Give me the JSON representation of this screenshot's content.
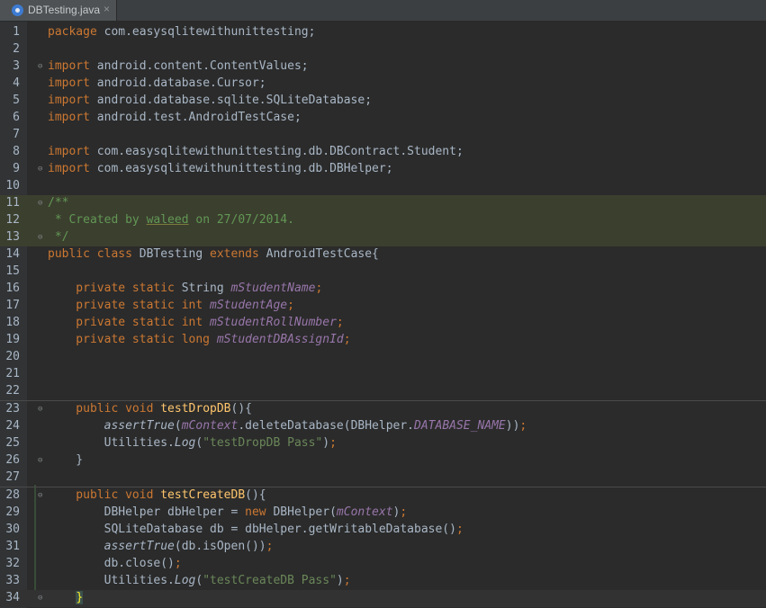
{
  "tab": {
    "title": "DBTesting.java",
    "close": "×"
  },
  "lines": [
    {
      "n": "1",
      "segs": [
        [
          "kw",
          "package"
        ],
        [
          "",
          "com.easysqlitewithunittesting;"
        ]
      ]
    },
    {
      "n": "2",
      "segs": []
    },
    {
      "n": "3",
      "fold": true,
      "segs": [
        [
          "kw",
          "import"
        ],
        [
          "",
          "android.content.ContentValues;"
        ]
      ]
    },
    {
      "n": "4",
      "segs": [
        [
          "kw",
          "import"
        ],
        [
          "",
          "android.database.Cursor;"
        ]
      ]
    },
    {
      "n": "5",
      "segs": [
        [
          "kw",
          "import"
        ],
        [
          "",
          "android.database.sqlite.SQLiteDatabase;"
        ]
      ]
    },
    {
      "n": "6",
      "segs": [
        [
          "kw",
          "import"
        ],
        [
          "",
          "android.test.AndroidTestCase;"
        ]
      ]
    },
    {
      "n": "7",
      "segs": []
    },
    {
      "n": "8",
      "segs": [
        [
          "kw",
          "import"
        ],
        [
          "",
          "com.easysqlitewithunittesting.db.DBContract.Student;"
        ]
      ]
    },
    {
      "n": "9",
      "fold": true,
      "segs": [
        [
          "kw",
          "import"
        ],
        [
          "",
          "com.easysqlitewithunittesting.db.DBHelper;"
        ]
      ]
    },
    {
      "n": "10",
      "segs": []
    },
    {
      "n": "11",
      "fold": true,
      "hl": true,
      "segs": [
        [
          "dc",
          "/**"
        ]
      ]
    },
    {
      "n": "12",
      "hl": true,
      "segs": [
        [
          "dc",
          " * Created by "
        ],
        [
          "dc u",
          "waleed"
        ],
        [
          "dc",
          " on 27/07/2014."
        ]
      ]
    },
    {
      "n": "13",
      "fold": true,
      "hl": true,
      "segs": [
        [
          "dc",
          " */"
        ]
      ]
    },
    {
      "n": "14",
      "segs": [
        [
          "kw",
          "public class"
        ],
        [
          "",
          "DBTesting "
        ],
        [
          "kw",
          "extends"
        ],
        [
          "",
          "AndroidTestCase{"
        ]
      ]
    },
    {
      "n": "15",
      "segs": []
    },
    {
      "n": "16",
      "segs": [
        [
          "kw",
          "    private static"
        ],
        [
          "",
          "String "
        ],
        [
          "fd",
          "mStudentName"
        ],
        [
          "kw",
          ";"
        ]
      ]
    },
    {
      "n": "17",
      "segs": [
        [
          "kw",
          "    private static int"
        ],
        [
          "fd",
          "mStudentAge"
        ],
        [
          "kw",
          ";"
        ]
      ]
    },
    {
      "n": "18",
      "segs": [
        [
          "kw",
          "    private static int"
        ],
        [
          "fd",
          "mStudentRollNumber"
        ],
        [
          "kw",
          ";"
        ]
      ]
    },
    {
      "n": "19",
      "segs": [
        [
          "kw",
          "    private static long"
        ],
        [
          "fd",
          "mStudentDBAssignId"
        ],
        [
          "kw",
          ";"
        ]
      ]
    },
    {
      "n": "20",
      "segs": []
    },
    {
      "n": "21",
      "segs": []
    },
    {
      "n": "22",
      "segs": []
    },
    {
      "n": "23",
      "fold": true,
      "sep": true,
      "segs": [
        [
          "kw",
          "    public void"
        ],
        [
          "fn",
          "testDropDB"
        ],
        [
          "",
          "(){"
        ]
      ]
    },
    {
      "n": "24",
      "segs": [
        [
          "it",
          "        assertTrue"
        ],
        [
          "",
          "("
        ],
        [
          "fd",
          "mContext"
        ],
        [
          "",
          ".deleteDatabase(DBHelper."
        ],
        [
          "fd",
          "DATABASE_NAME"
        ],
        [
          "",
          "))"
        ],
        [
          "kw",
          ";"
        ]
      ]
    },
    {
      "n": "25",
      "segs": [
        [
          "",
          "        Utilities."
        ],
        [
          "it",
          "Log"
        ],
        [
          "",
          "("
        ],
        [
          "st",
          "\"testDropDB Pass\""
        ],
        [
          "",
          ")"
        ],
        [
          "kw",
          ";"
        ]
      ]
    },
    {
      "n": "26",
      "fold": true,
      "segs": [
        [
          "",
          "    }"
        ]
      ]
    },
    {
      "n": "27",
      "segs": []
    },
    {
      "n": "28",
      "fold": true,
      "sep": true,
      "segs": [
        [
          "kw",
          "    public void"
        ],
        [
          "fn",
          "testCreateDB"
        ],
        [
          "",
          "(){"
        ]
      ]
    },
    {
      "n": "29",
      "segs": [
        [
          "",
          "        DBHelper dbHelper = "
        ],
        [
          "kw",
          "new"
        ],
        [
          "",
          "DBHelper("
        ],
        [
          "fd",
          "mContext"
        ],
        [
          "",
          ")"
        ],
        [
          "kw",
          ";"
        ]
      ]
    },
    {
      "n": "30",
      "segs": [
        [
          "",
          "        SQLiteDatabase db = dbHelper.getWritableDatabase()"
        ],
        [
          "kw",
          ";"
        ]
      ]
    },
    {
      "n": "31",
      "segs": [
        [
          "it",
          "        assertTrue"
        ],
        [
          "",
          "(db.isOpen())"
        ],
        [
          "kw",
          ";"
        ]
      ]
    },
    {
      "n": "32",
      "segs": [
        [
          "",
          "        db.close()"
        ],
        [
          "kw",
          ";"
        ]
      ]
    },
    {
      "n": "33",
      "segs": [
        [
          "",
          "        Utilities."
        ],
        [
          "it",
          "Log"
        ],
        [
          "",
          "("
        ],
        [
          "st",
          "\"testCreateDB Pass\""
        ],
        [
          "",
          ")"
        ],
        [
          "kw",
          ";"
        ]
      ]
    },
    {
      "n": "34",
      "fold": true,
      "cur": true,
      "segs": [
        [
          "",
          "    "
        ],
        [
          "brace",
          "}"
        ]
      ]
    }
  ]
}
